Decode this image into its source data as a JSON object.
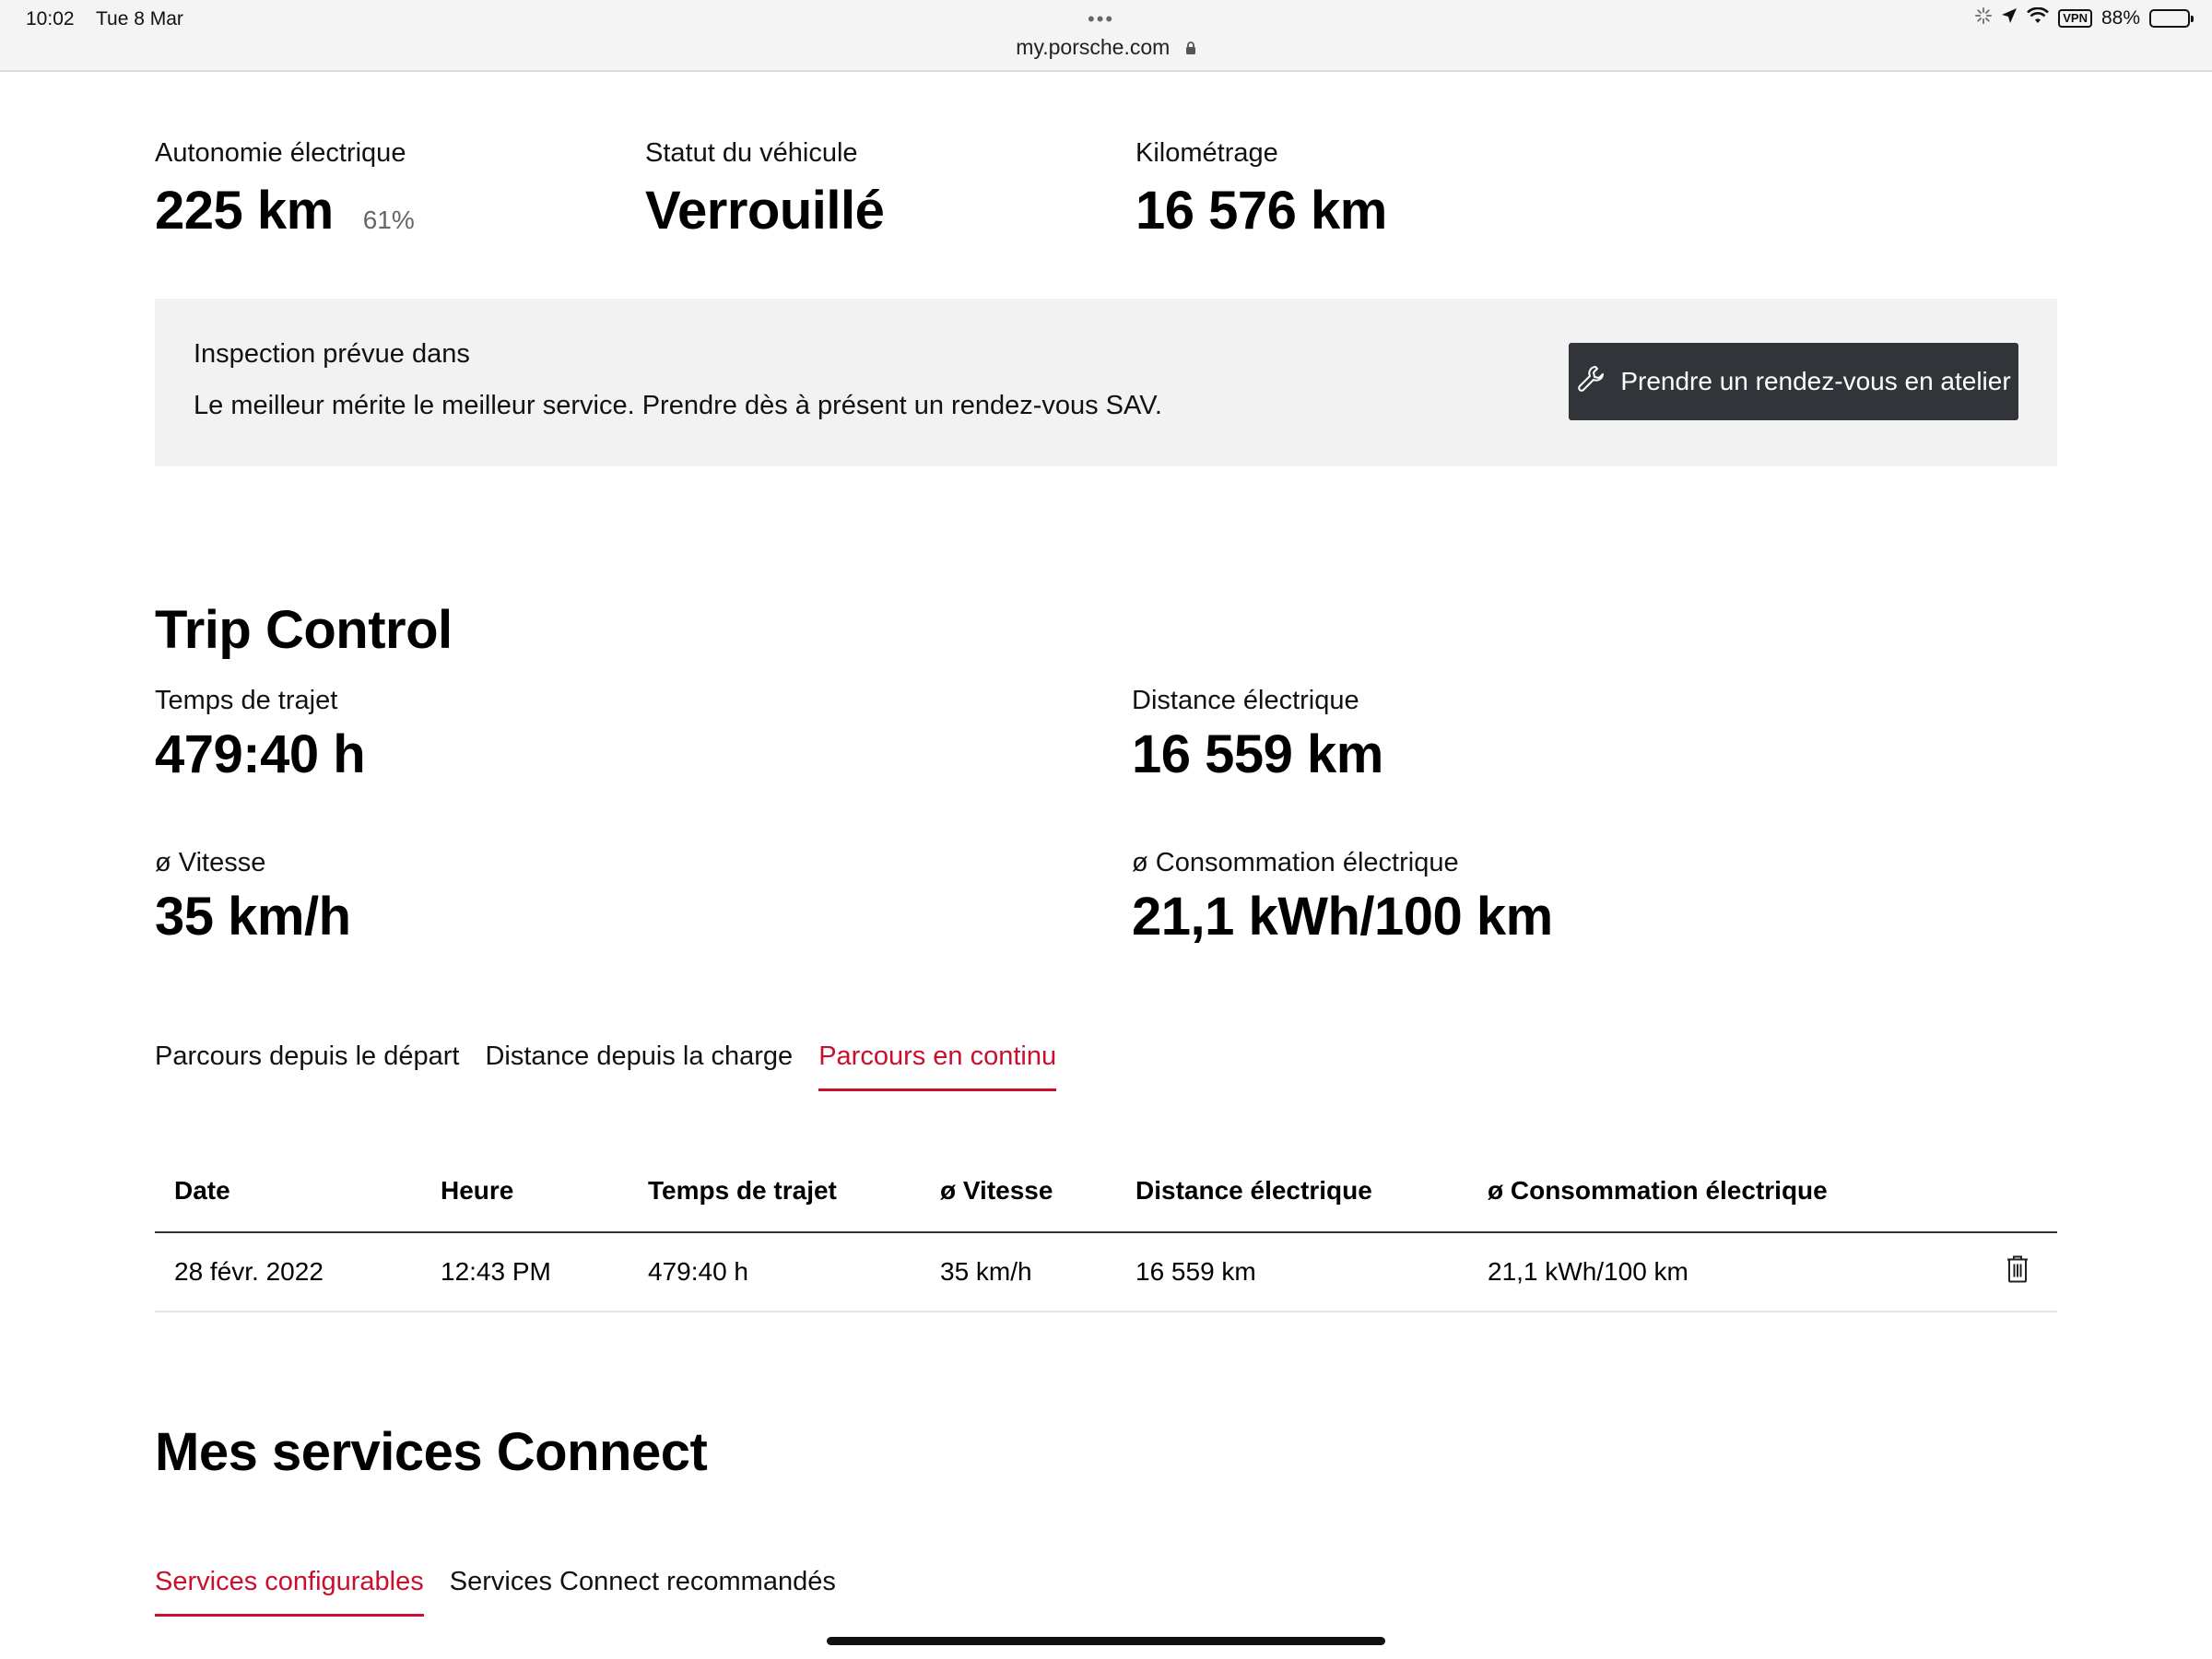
{
  "status_bar": {
    "time": "10:02",
    "date": "Tue 8 Mar",
    "url": "my.porsche.com",
    "vpn": "VPN",
    "battery": "88%",
    "battery_level": 0.88
  },
  "overview": {
    "range_label": "Autonomie électrique",
    "range_value": "225 km",
    "range_pct": "61%",
    "status_label": "Statut du véhicule",
    "status_value": "Verrouillé",
    "mileage_label": "Kilométrage",
    "mileage_value": "16 576 km"
  },
  "inspection": {
    "title": "Inspection prévue dans",
    "text": "Le meilleur mérite le meilleur service. Prendre dès à présent un rendez-vous SAV.",
    "button_label": "Prendre un rendez-vous en atelier"
  },
  "trip_control": {
    "title": "Trip Control",
    "stats": [
      {
        "label": "Temps de trajet",
        "value": "479:40 h"
      },
      {
        "label": "Distance électrique",
        "value": "16 559 km"
      },
      {
        "label": "ø Vitesse",
        "value": "35 km/h"
      },
      {
        "label": "ø Consommation électrique",
        "value": "21,1 kWh/100 km"
      }
    ],
    "tabs": [
      "Parcours depuis le départ",
      "Distance depuis la charge",
      "Parcours en continu"
    ],
    "active_tab": 2,
    "table": {
      "headers": [
        "Date",
        "Heure",
        "Temps de trajet",
        "ø Vitesse",
        "Distance électrique",
        "ø Consommation électrique"
      ],
      "rows": [
        [
          "28 févr. 2022",
          "12:43 PM",
          "479:40 h",
          "35 km/h",
          "16 559 km",
          "21,1 kWh/100 km"
        ]
      ]
    }
  },
  "connect": {
    "title": "Mes services Connect",
    "tabs": [
      "Services configurables",
      "Services Connect recommandés"
    ],
    "active_tab": 0
  },
  "colors": {
    "accent": "#c8102e",
    "button_bg": "#313439",
    "panel_bg": "#f2f2f2"
  }
}
